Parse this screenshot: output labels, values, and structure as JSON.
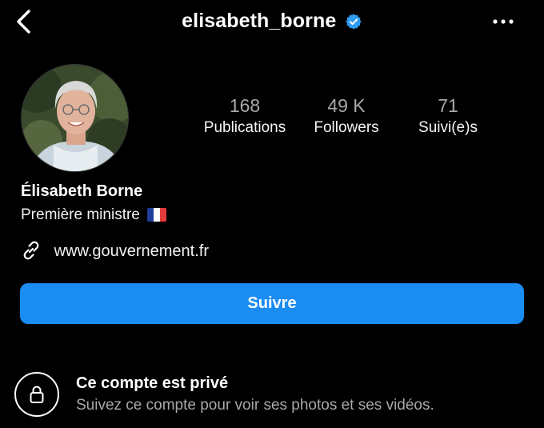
{
  "header": {
    "username": "elisabeth_borne",
    "back_icon": "chevron-left-icon",
    "verified_icon": "verified-badge-icon",
    "more_icon": "more-horizontal-icon"
  },
  "stats": {
    "posts": {
      "value": "168",
      "label": "Publications"
    },
    "followers": {
      "value": "49 K",
      "label": "Followers"
    },
    "following": {
      "value": "71",
      "label": "Suivi(e)s"
    }
  },
  "profile": {
    "full_name": "Élisabeth Borne",
    "bio": "Première ministre",
    "bio_emoji": "french-flag",
    "website": "www.gouvernement.fr"
  },
  "actions": {
    "follow_label": "Suivre"
  },
  "private_notice": {
    "title": "Ce compte est privé",
    "subtitle": "Suivez ce compte pour voir ses photos et ses vidéos."
  },
  "colors": {
    "background": "#000000",
    "accent": "#1a8cf2",
    "verified": "#2f9bf3",
    "muted_text": "#a8a8a8",
    "flag_blue": "#1f3f9a",
    "flag_white": "#ffffff",
    "flag_red": "#e33b3b"
  }
}
